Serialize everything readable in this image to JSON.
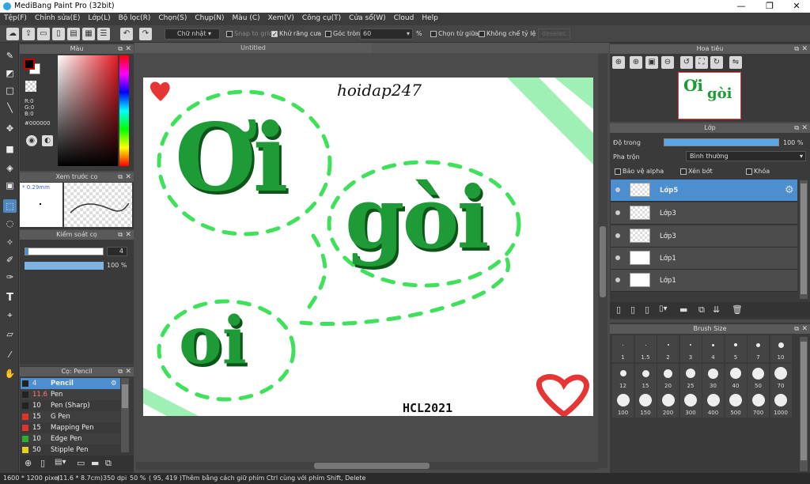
{
  "window": {
    "title": "MediBang Paint Pro (32bit)",
    "btn_min": "—",
    "btn_max": "❐",
    "btn_close": "✕"
  },
  "menu": [
    "Tệp(F)",
    "Chỉnh sửa(E)",
    "Lớp(L)",
    "Bộ lọc(R)",
    "Chọn(S)",
    "Chụp(N)",
    "Màu (C)",
    "Xem(V)",
    "Công cụ(T)",
    "Cửa sổ(W)",
    "Cloud",
    "Help"
  ],
  "toolbar": {
    "select_mode": "Chữ nhật",
    "snap": "Snap to grid",
    "antialias": "Khử răng cưa",
    "round_corner": "Góc tròn",
    "round_value": "60",
    "percent": "%",
    "select_center": "Chọn từ giữa",
    "fixed_ratio": "Không chế tỷ lệ",
    "deselect": "deselec"
  },
  "color_panel": {
    "title": "Màu",
    "r": "R:0",
    "g": "G:0",
    "b": "B:0",
    "hex": "#000000"
  },
  "brush_preview": {
    "title": "Xem trước cọ",
    "size": "* 0.29mm"
  },
  "brush_control": {
    "title": "Kiểm soát cọ",
    "size": "4",
    "opacity": "100 %"
  },
  "brush_list": {
    "title": "Cọ: Pencil",
    "items": [
      {
        "size": "4",
        "name": "Pencil",
        "color": "#222222"
      },
      {
        "size": "11.6",
        "name": "Pen",
        "color": "#222222"
      },
      {
        "size": "10",
        "name": "Pen (Sharp)",
        "color": "#222222"
      },
      {
        "size": "15",
        "name": "G Pen",
        "color": "#e53030"
      },
      {
        "size": "15",
        "name": "Mapping Pen",
        "color": "#e53030"
      },
      {
        "size": "10",
        "name": "Edge Pen",
        "color": "#2ab02a"
      },
      {
        "size": "50",
        "name": "Stipple Pen",
        "color": "#e0d020"
      }
    ]
  },
  "canvas": {
    "tab": "Untitled",
    "signature_top": "hoidap247",
    "signature_bottom": "HCL2021",
    "word1": "Ơi",
    "word2": "gòi",
    "word3": "oi"
  },
  "navigator": {
    "title": "Hoa tiêu"
  },
  "layers_panel": {
    "title": "Lớp",
    "opacity_label": "Độ trong",
    "opacity_value": "100 %",
    "blend_label": "Pha trộn",
    "blend_value": "Bình thường",
    "protect_alpha": "Bảo vệ alpha",
    "clip": "Xén bớt",
    "lock": "Khóa",
    "layers": [
      {
        "name": "Lớp5",
        "selected": true
      },
      {
        "name": "Lớp3"
      },
      {
        "name": "Lớp3"
      },
      {
        "name": "Lớp1"
      },
      {
        "name": "Lớp1"
      }
    ]
  },
  "brush_size": {
    "title": "Brush Size",
    "row1": [
      "1",
      "1.5",
      "2",
      "3",
      "4",
      "5",
      "7",
      "10"
    ],
    "row2": [
      "12",
      "15",
      "20",
      "25",
      "30",
      "40",
      "50",
      "70"
    ],
    "row3": [
      "100",
      "150",
      "200",
      "300",
      "400",
      "500",
      "700",
      "1000"
    ]
  },
  "status": {
    "dims": "1600 * 1200 pixel",
    "cm": "(11.6 * 8.7cm)",
    "dpi": "350 dpi",
    "zoom": "50 %",
    "coords": "( 95, 419 )",
    "hint": "Thêm bằng cách giữ phím Ctrl cùng với phím Shift, Delete"
  }
}
